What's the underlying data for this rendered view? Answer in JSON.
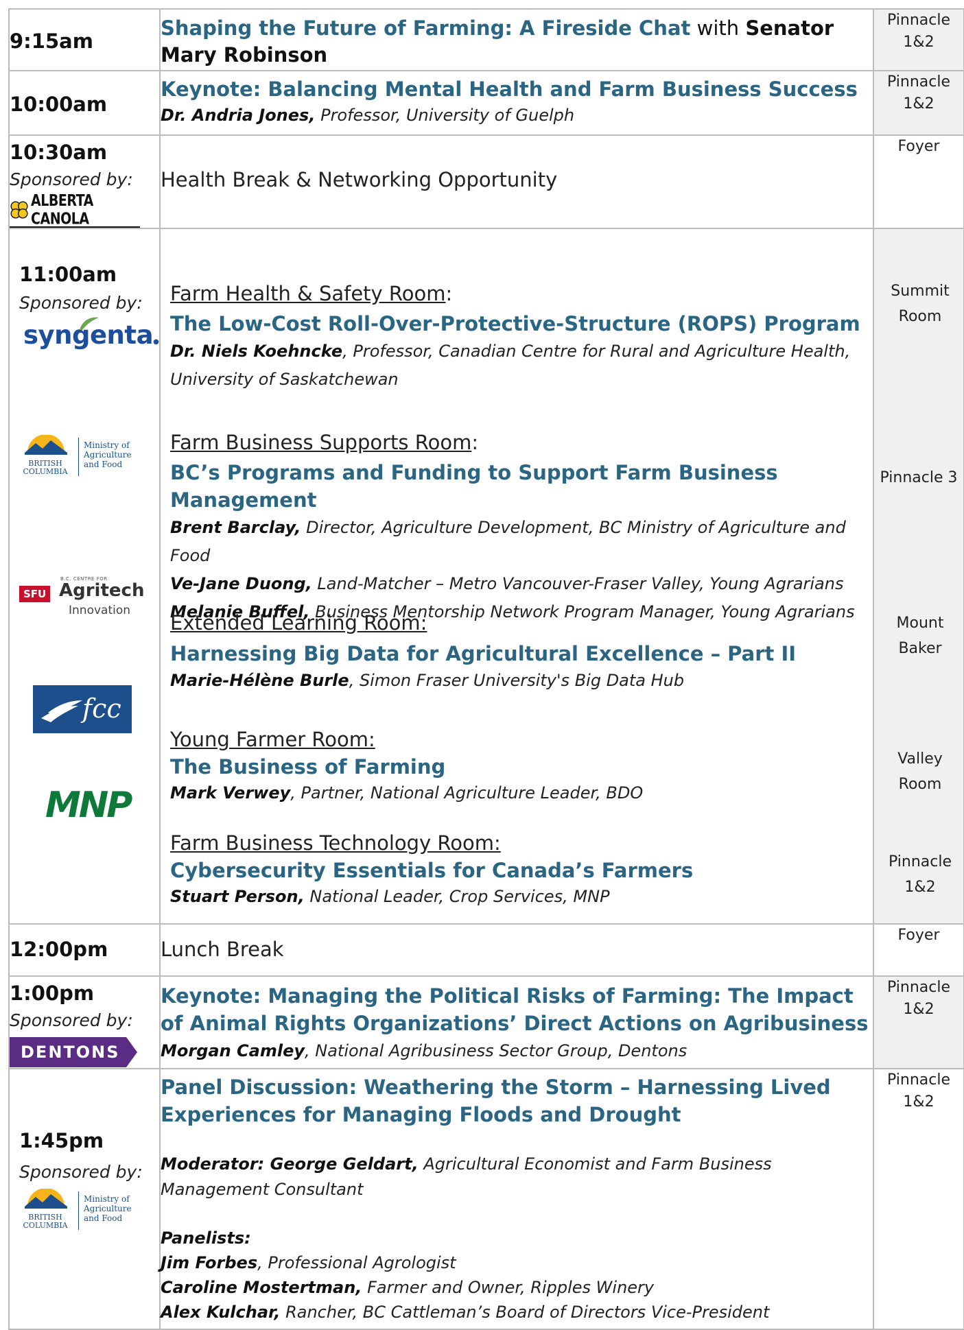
{
  "rows": {
    "r1": {
      "time": "9:15am",
      "title": "Shaping the Future of Farming: A Fireside Chat",
      "with": "with",
      "guest": "Senator Mary Robinson",
      "room": "Pinnacle 1&2"
    },
    "r2": {
      "time": "10:00am",
      "title": "Keynote: Balancing Mental Health and Farm Business Success",
      "speaker": "Dr. Andria Jones,",
      "speaker_role": "Professor, University of Guelph",
      "room": "Pinnacle 1&2"
    },
    "r3": {
      "time": "10:30am",
      "sponsored": "Sponsored by:",
      "logo_text": "ALBERTA CANOLA",
      "event": "Health Break & Networking Opportunity",
      "room": "Foyer"
    },
    "r4": {
      "time": "11:00am",
      "sponsored": "Sponsored by:",
      "logos": {
        "syngenta": "syngenta",
        "bc_name": "BRITISH COLUMBIA",
        "bc_ministry": "Ministry of Agriculture and Food",
        "sfu": "SFU",
        "agritech_top": "B.C. CENTRE FOR",
        "agritech": "Agritech",
        "agritech_sub": "Innovation",
        "fcc": "fcc",
        "mnp": "MNP"
      },
      "sessions": [
        {
          "room_label": "Farm Health & Safety Room",
          "room_suffix": ":",
          "title": "The Low-Cost Roll-Over-Protective-Structure (ROPS) Program",
          "speakers": [
            {
              "name": "Dr. Niels Koehncke",
              "role": ", Professor, Canadian Centre for Rural and Agriculture Health, University of Saskatchewan"
            }
          ],
          "room": "Summit Room"
        },
        {
          "room_label": "Farm Business Supports Room",
          "room_suffix": ":",
          "title": "BC’s Programs and Funding to Support Farm Business Management",
          "speakers": [
            {
              "name": "Brent Barclay,",
              "role": " Director, Agriculture Development, BC Ministry of Agriculture and Food"
            },
            {
              "name": "Ve-Jane Duong,",
              "role": " Land-Matcher – Metro Vancouver-Fraser Valley, Young Agrarians"
            },
            {
              "name": "Melanie Buffel,",
              "role": " Business Mentorship Network Program Manager, Young Agrarians"
            }
          ],
          "room": "Pinnacle 3"
        },
        {
          "room_label": "Extended Learning Room:",
          "room_suffix": "",
          "title": "Harnessing Big Data for Agricultural Excellence – Part II",
          "speakers": [
            {
              "name": "Marie-Hélène Burle",
              "role": ", Simon Fraser University's Big Data Hub"
            }
          ],
          "room": "Mount Baker"
        },
        {
          "room_label": "Young Farmer Room:",
          "room_suffix": "",
          "title": "The Business of Farming",
          "speakers": [
            {
              "name": "Mark Verwey",
              "role": ", Partner, National Agriculture Leader, BDO"
            }
          ],
          "room": "Valley Room"
        },
        {
          "room_label": "Farm Business Technology Room:",
          "room_suffix": "",
          "title": "Cybersecurity Essentials for Canada’s Farmers",
          "speakers": [
            {
              "name": "Stuart Person,",
              "role": " National Leader, Crop Services, MNP"
            }
          ],
          "room": "Pinnacle 1&2"
        }
      ]
    },
    "r5": {
      "time": "12:00pm",
      "event": "Lunch Break",
      "room": "Foyer"
    },
    "r6": {
      "time": "1:00pm",
      "sponsored": "Sponsored by:",
      "logo_text": "DENTONS",
      "title": "Keynote: Managing the Political Risks of Farming:  The Impact of Animal Rights Organizations’ Direct Actions on Agribusiness",
      "speaker": "Morgan Camley",
      "speaker_role": ", National Agribusiness Sector Group, Dentons",
      "room": "Pinnacle 1&2"
    },
    "r7": {
      "time": "1:45pm",
      "sponsored": "Sponsored by:",
      "logo_bc_name": "BRITISH COLUMBIA",
      "logo_bc_ministry": "Ministry of Agriculture and Food",
      "title": "Panel Discussion: Weathering the Storm – Harnessing Lived Experiences for Managing Floods and Drought",
      "moderator": "Moderator: George Geldart,",
      "moderator_role": " Agricultural Economist and Farm Business Management Consultant",
      "panelists_label": "Panelists:",
      "panelists": [
        {
          "name": "Jim Forbes",
          "role": ", Professional Agrologist"
        },
        {
          "name": "Caroline Mostertman,",
          "role": " Farmer and Owner, Ripples Winery"
        },
        {
          "name": "Alex Kulchar,",
          "role": " Rancher, BC Cattleman’s Board of Directors Vice-President"
        }
      ],
      "room": "Pinnacle 1&2"
    }
  },
  "colors": {
    "title_blue": "#2b6584",
    "room_bg": "#f0f0f0",
    "border": "#bcbcbc",
    "dentons_purple": "#5b2c83",
    "mnp_green": "#0d7a3a",
    "syngenta_blue": "#1d4e9e",
    "fcc_blue": "#1c4f8c",
    "canola_yellow": "#f4c81c",
    "sfu_red": "#c8102e"
  }
}
